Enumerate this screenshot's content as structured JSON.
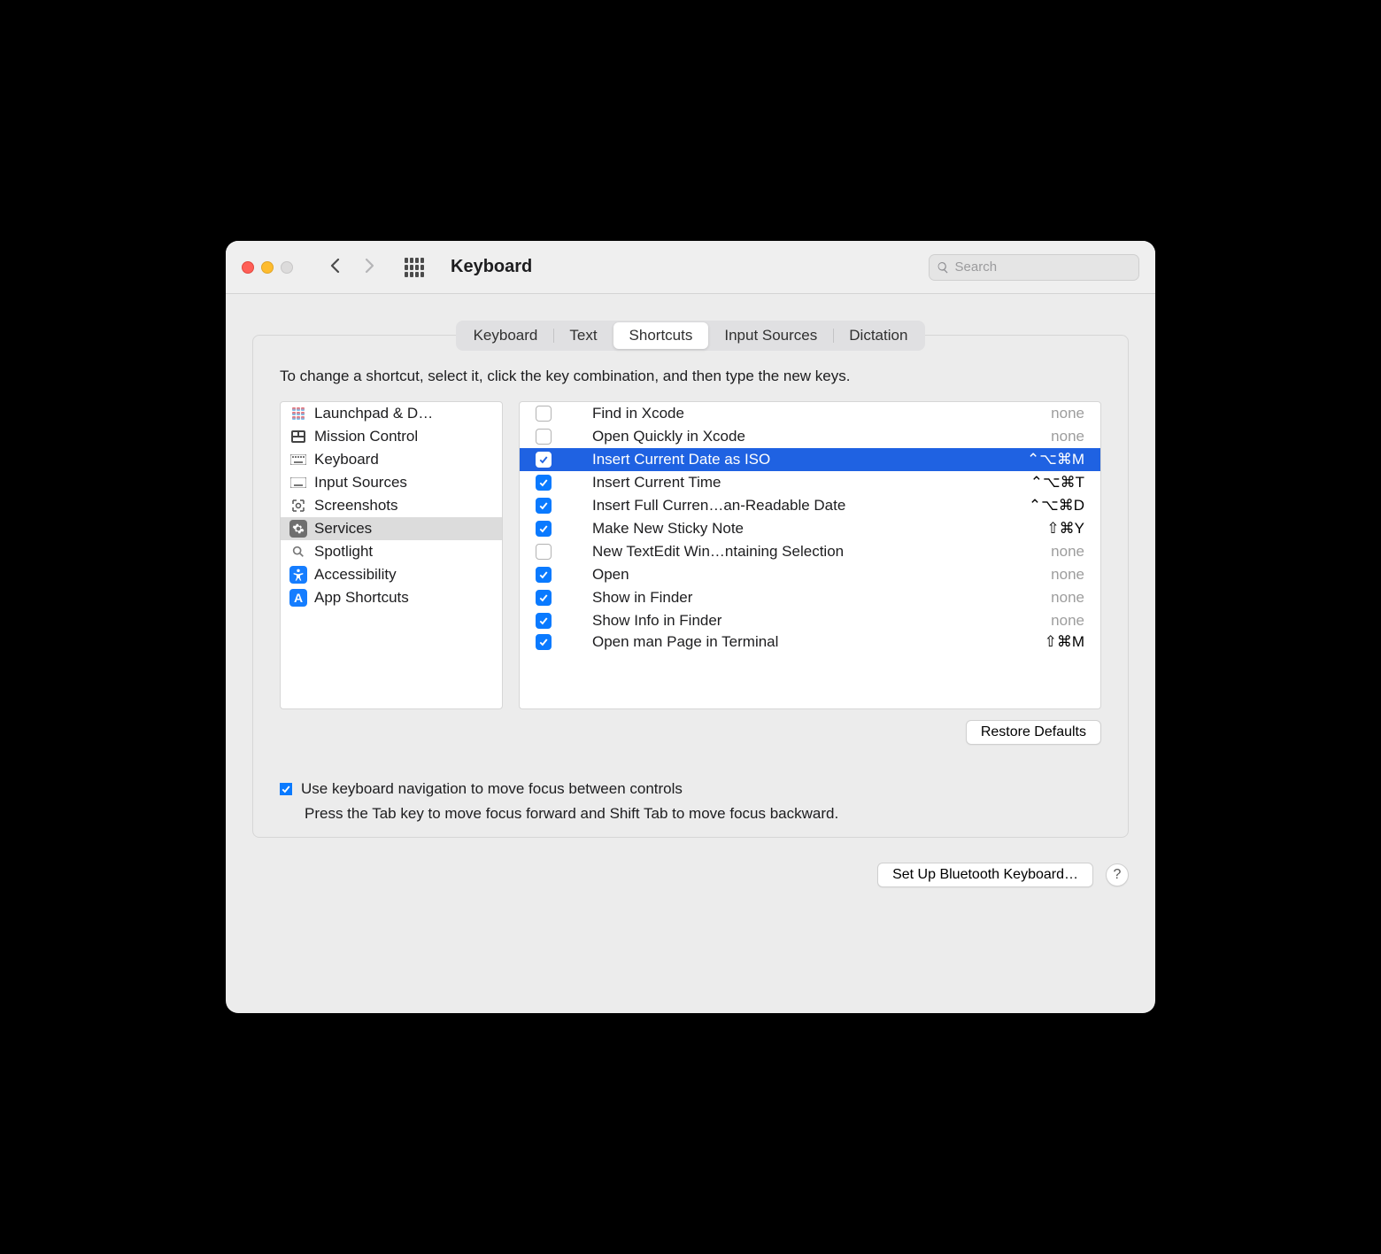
{
  "header": {
    "title": "Keyboard",
    "search_placeholder": "Search"
  },
  "tabs": [
    {
      "label": "Keyboard",
      "active": false
    },
    {
      "label": "Text",
      "active": false
    },
    {
      "label": "Shortcuts",
      "active": true
    },
    {
      "label": "Input Sources",
      "active": false
    },
    {
      "label": "Dictation",
      "active": false
    }
  ],
  "instructions": "To change a shortcut, select it, click the key combination, and then type the new keys.",
  "sidebar": {
    "items": [
      {
        "label": "Launchpad & D…",
        "icon": "launchpad"
      },
      {
        "label": "Mission Control",
        "icon": "mission"
      },
      {
        "label": "Keyboard",
        "icon": "keyboard"
      },
      {
        "label": "Input Sources",
        "icon": "input"
      },
      {
        "label": "Screenshots",
        "icon": "screenshot"
      },
      {
        "label": "Services",
        "icon": "services",
        "selected": true
      },
      {
        "label": "Spotlight",
        "icon": "spotlight"
      },
      {
        "label": "Accessibility",
        "icon": "accessibility"
      },
      {
        "label": "App Shortcuts",
        "icon": "appshortcuts"
      }
    ]
  },
  "shortcuts": [
    {
      "checked": false,
      "label": "Find in Xcode",
      "key": "none",
      "key_display": "none"
    },
    {
      "checked": false,
      "label": "Open Quickly in Xcode",
      "key": "none",
      "key_display": "none"
    },
    {
      "checked": true,
      "label": "Insert Current Date as ISO",
      "key": "^⌥⌘M",
      "key_display": "⌃⌥⌘M",
      "selected": true
    },
    {
      "checked": true,
      "label": "Insert Current Time",
      "key": "^⌥⌘T",
      "key_display": "⌃⌥⌘T"
    },
    {
      "checked": true,
      "label": "Insert Full Curren…an-Readable Date",
      "key": "^⌥⌘D",
      "key_display": "⌃⌥⌘D"
    },
    {
      "checked": true,
      "label": "Make New Sticky Note",
      "key": "⇧⌘Y",
      "key_display": "⇧⌘Y"
    },
    {
      "checked": false,
      "label": "New TextEdit Win…ntaining Selection",
      "key": "none",
      "key_display": "none"
    },
    {
      "checked": true,
      "label": "Open",
      "key": "none",
      "key_display": "none"
    },
    {
      "checked": true,
      "label": "Show in Finder",
      "key": "none",
      "key_display": "none"
    },
    {
      "checked": true,
      "label": "Show Info in Finder",
      "key": "none",
      "key_display": "none"
    },
    {
      "checked": true,
      "label": "Open man Page in Terminal",
      "key": "⇧⌘M",
      "key_display": "⇧⌘M",
      "partial": true
    }
  ],
  "restore_button": "Restore Defaults",
  "nav_option": {
    "checked": true,
    "label": "Use keyboard navigation to move focus between controls",
    "hint": "Press the Tab key to move focus forward and Shift Tab to move focus backward."
  },
  "footer": {
    "setup_button": "Set Up Bluetooth Keyboard…",
    "help": "?"
  },
  "colors": {
    "accent": "#0a7aff",
    "selection": "#1f62e2"
  }
}
